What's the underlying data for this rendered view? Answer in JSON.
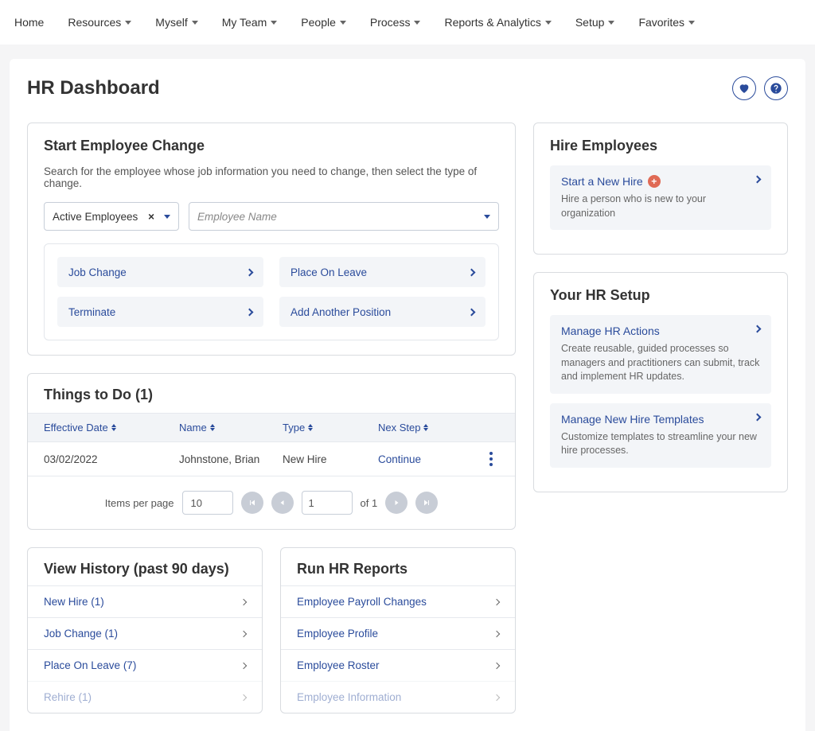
{
  "nav": {
    "items": [
      {
        "label": "Home",
        "hasCaret": false
      },
      {
        "label": "Resources",
        "hasCaret": true
      },
      {
        "label": "Myself",
        "hasCaret": true
      },
      {
        "label": "My Team",
        "hasCaret": true
      },
      {
        "label": "People",
        "hasCaret": true
      },
      {
        "label": "Process",
        "hasCaret": true
      },
      {
        "label": "Reports & Analytics",
        "hasCaret": true
      },
      {
        "label": "Setup",
        "hasCaret": true
      },
      {
        "label": "Favorites",
        "hasCaret": true
      }
    ]
  },
  "page": {
    "title": "HR Dashboard"
  },
  "startChange": {
    "title": "Start Employee Change",
    "description": "Search for the employee whose job information you need to change, then select the type of change.",
    "filterValue": "Active Employees",
    "searchPlaceholder": "Employee Name",
    "actions": [
      "Job Change",
      "Place On Leave",
      "Terminate",
      "Add Another Position"
    ]
  },
  "thingsToDo": {
    "title": "Things to Do (1)",
    "columns": [
      "Effective Date",
      "Name",
      "Type",
      "Nex Step"
    ],
    "rows": [
      {
        "date": "03/02/2022",
        "name": "Johnstone, Brian",
        "type": "New Hire",
        "next": "Continue"
      }
    ],
    "pager": {
      "itemsPerPageLabel": "Items per page",
      "perPage": "10",
      "pageNum": "1",
      "ofLabel": "of 1"
    }
  },
  "viewHistory": {
    "title": "View History (past 90 days)",
    "items": [
      "New Hire (1)",
      "Job Change (1)",
      "Place On Leave (7)",
      "Rehire (1)"
    ]
  },
  "runReports": {
    "title": "Run HR Reports",
    "items": [
      "Employee Payroll Changes",
      "Employee Profile",
      "Employee Roster",
      "Employee Information"
    ]
  },
  "hireEmployees": {
    "title": "Hire Employees",
    "cards": [
      {
        "title": "Start a New Hire",
        "desc": "Hire a person who is new to your organization",
        "plus": true
      }
    ]
  },
  "hrSetup": {
    "title": "Your HR Setup",
    "cards": [
      {
        "title": "Manage HR Actions",
        "desc": "Create reusable, guided processes so managers and practitioners can submit, track and implement HR updates."
      },
      {
        "title": "Manage New Hire Templates",
        "desc": "Customize templates to streamline your new hire processes."
      }
    ]
  }
}
